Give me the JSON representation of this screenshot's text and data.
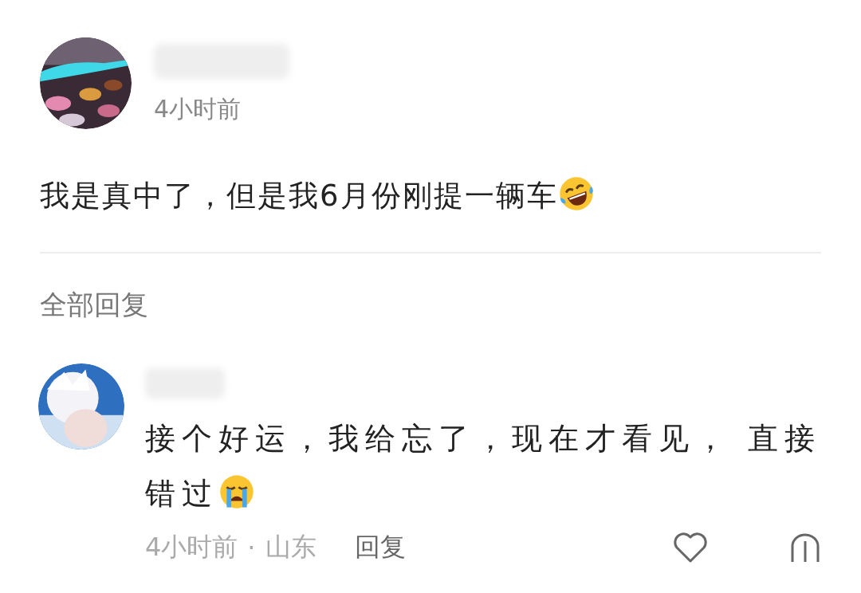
{
  "post": {
    "time": "4小时前",
    "text": "我是真中了，但是我6月份刚提一辆车",
    "emoji": {
      "kind": "laughing"
    }
  },
  "replies_header": "全部回复",
  "replies": [
    {
      "text": "接个好运，我给忘了，现在才看见， 直接错过",
      "emoji": {
        "kind": "crying"
      },
      "time": "4小时前",
      "separator": "·",
      "location": "山东",
      "reply_label": "回复",
      "liked": false
    }
  ]
}
